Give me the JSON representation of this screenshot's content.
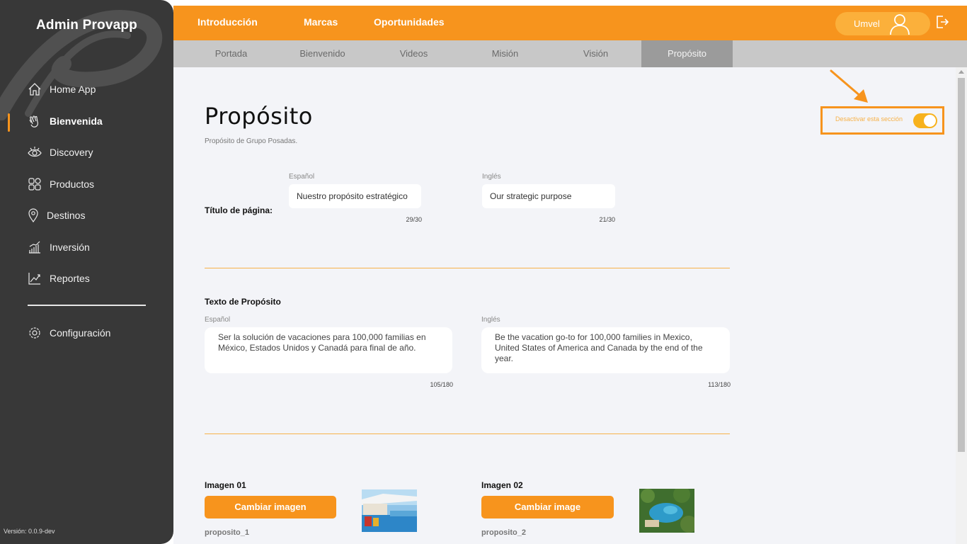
{
  "sidebar": {
    "app_title": "Admin Provapp",
    "items": [
      {
        "label": "Home App",
        "icon": "home-icon"
      },
      {
        "label": "Bienvenida",
        "icon": "wave-hand-icon",
        "active": true
      },
      {
        "label": "Discovery",
        "icon": "eye-icon"
      },
      {
        "label": "Productos",
        "icon": "grid-icon"
      },
      {
        "label": "Destinos",
        "icon": "location-pin-icon"
      },
      {
        "label": "Inversión",
        "icon": "bar-chart-icon"
      },
      {
        "label": "Reportes",
        "icon": "trend-line-icon"
      }
    ],
    "settings_label": "Configuración",
    "version": "Versión: 0.0.9-dev"
  },
  "topbar": {
    "tabs": [
      "Introducción",
      "Marcas",
      "Oportunidades"
    ],
    "user_name": "Umvel"
  },
  "subtabs": {
    "items": [
      "Portada",
      "Bienvenido",
      "Videos",
      "Misión",
      "Visión",
      "Propósito"
    ],
    "active": "Propósito"
  },
  "page": {
    "title": "Propósito",
    "subtitle": "Propósito de Grupo Posadas.",
    "toggle_label": "Desactivar esta sección",
    "toggle_on": true
  },
  "title_section": {
    "row_label": "Título de página:",
    "es_label": "Español",
    "en_label": "Inglés",
    "es_value": "Nuestro propósito estratégico",
    "en_value": "Our strategic purpose",
    "es_counter": "29/30",
    "en_counter": "21/30"
  },
  "text_section": {
    "heading": "Texto de Propósito",
    "es_label": "Español",
    "en_label": "Inglés",
    "es_value": "Ser la solución de vacaciones para 100,000 familias en México, Estados Unidos y Canadá para final de año.",
    "en_value": "Be the vacation go-to for 100,000 families in Mexico, United States of America and Canada by the end of the year.",
    "es_counter": "105/180",
    "en_counter": "113/180"
  },
  "images": [
    {
      "label": "Imagen 01",
      "button": "Cambiar imagen",
      "filename": "proposito_1"
    },
    {
      "label": "Imagen 02",
      "button": "Cambiar image",
      "filename": "proposito_2"
    }
  ],
  "colors": {
    "accent": "#f7941d",
    "sidebar": "#383838",
    "content_bg": "#f3f4f8"
  }
}
